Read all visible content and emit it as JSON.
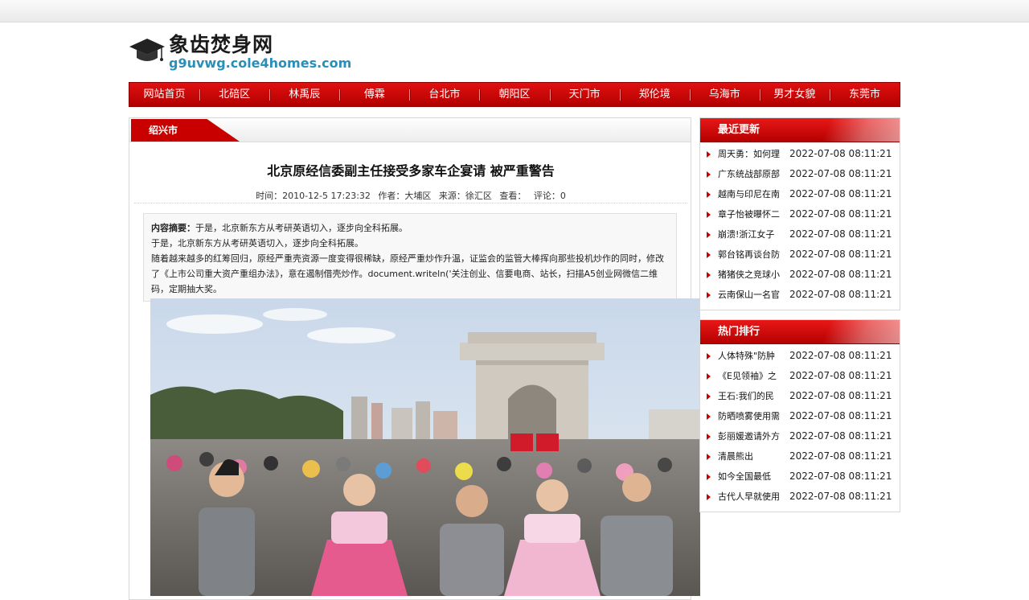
{
  "site": {
    "title": "象齿焚身网",
    "domain": "g9uvwg.cole4homes.com"
  },
  "nav": [
    "网站首页",
    "北碚区",
    "林禹辰",
    "傅霖",
    "台北市",
    "朝阳区",
    "天门市",
    "郑伦境",
    "乌海市",
    "男才女貌",
    "东莞市"
  ],
  "main": {
    "tab": "绍兴市",
    "title": "北京原经信委副主任接受多家车企宴请 被严重警告",
    "meta": {
      "time": "时间：2010-12-5 17:23:32",
      "author": "作者：大埔区",
      "source": "来源：徐汇区",
      "views": "查看：",
      "comments": "评论：0"
    },
    "summary_label": "内容摘要：",
    "summary_first": "于是，北京新东方从考研英语切入，逐步向全科拓展。",
    "paragraph1": "于是，北京新东方从考研英语切入，逐步向全科拓展。",
    "paragraph2": "随着越来越多的红筹回归，原经严重壳资源一度变得很稀缺，原经严重炒作升温，证监会的监管大棒挥向那些投机炒作的同时，修改了《上市公司重大资产重组办法》，意在遏制借壳炒作。document.writeln('关注创业、信要电商、站长，扫描A5创业网微信二维码，定期抽大奖。"
  },
  "recent": {
    "title": "最近更新",
    "items": [
      {
        "t": "周天勇：如何理",
        "d": "2022-07-08 08:11:21"
      },
      {
        "t": "广东统战部原部",
        "d": "2022-07-08 08:11:21"
      },
      {
        "t": "越南与印尼在南",
        "d": "2022-07-08 08:11:21"
      },
      {
        "t": "章子怡被曝怀二",
        "d": "2022-07-08 08:11:21"
      },
      {
        "t": "崩溃!浙江女子",
        "d": "2022-07-08 08:11:21"
      },
      {
        "t": "郭台铭再谈台防",
        "d": "2022-07-08 08:11:21"
      },
      {
        "t": "猪猪侠之竞球小",
        "d": "2022-07-08 08:11:21"
      },
      {
        "t": "云南保山一名官",
        "d": "2022-07-08 08:11:21"
      }
    ]
  },
  "hot": {
    "title": "热门排行",
    "items": [
      {
        "t": "人体特殊\"防肿",
        "d": "2022-07-08 08:11:21"
      },
      {
        "t": "《E见领袖》之",
        "d": "2022-07-08 08:11:21"
      },
      {
        "t": "王石:我们的民",
        "d": "2022-07-08 08:11:21"
      },
      {
        "t": "防晒喷雾使用需",
        "d": "2022-07-08 08:11:21"
      },
      {
        "t": "彭丽媛邀请外方",
        "d": "2022-07-08 08:11:21"
      },
      {
        "t": "清晨熊出",
        "d": "2022-07-08 08:11:21"
      },
      {
        "t": "如今全国最低",
        "d": "2022-07-08 08:11:21"
      },
      {
        "t": "古代人早就使用",
        "d": "2022-07-08 08:11:21"
      }
    ]
  },
  "colors": {
    "accent_red": "#c80000",
    "domain_blue": "#2a8fb8"
  }
}
